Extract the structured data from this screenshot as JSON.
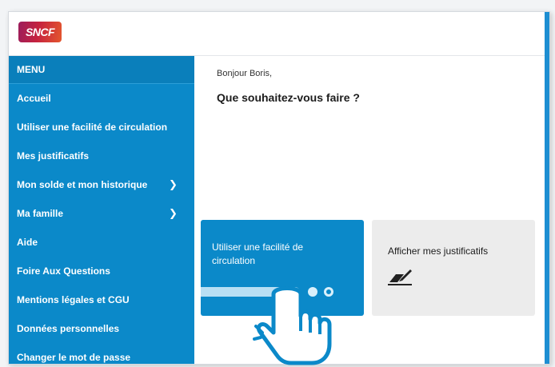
{
  "header": {
    "logo_text": "SNCF"
  },
  "sidebar": {
    "menu_label": "MENU",
    "items": [
      {
        "label": "Accueil",
        "has_chevron": false
      },
      {
        "label": "Utiliser une facilité de circulation",
        "has_chevron": false
      },
      {
        "label": "Mes justificatifs",
        "has_chevron": false
      },
      {
        "label": "Mon solde et mon historique",
        "has_chevron": true
      },
      {
        "label": "Ma famille",
        "has_chevron": true
      },
      {
        "label": "Aide",
        "has_chevron": false
      },
      {
        "label": "Foire Aux Questions",
        "has_chevron": false
      },
      {
        "label": "Mentions légales et CGU",
        "has_chevron": false
      },
      {
        "label": "Données personnelles",
        "has_chevron": false
      },
      {
        "label": "Changer le mot de passe",
        "has_chevron": false
      }
    ]
  },
  "main": {
    "greeting": "Bonjour Boris,",
    "question": "Que souhaitez-vous faire ?",
    "cards": [
      {
        "label": "Utiliser une facilité de circulation",
        "style": "primary"
      },
      {
        "label": "Afficher mes justificatifs",
        "icon": "document-pen-icon",
        "style": "secondary"
      }
    ]
  },
  "colors": {
    "sidebar_blue": "#0b89c9",
    "card_gray": "#ececec",
    "logo_gradient_start": "#9b1d5c",
    "logo_gradient_end": "#e4572e"
  }
}
